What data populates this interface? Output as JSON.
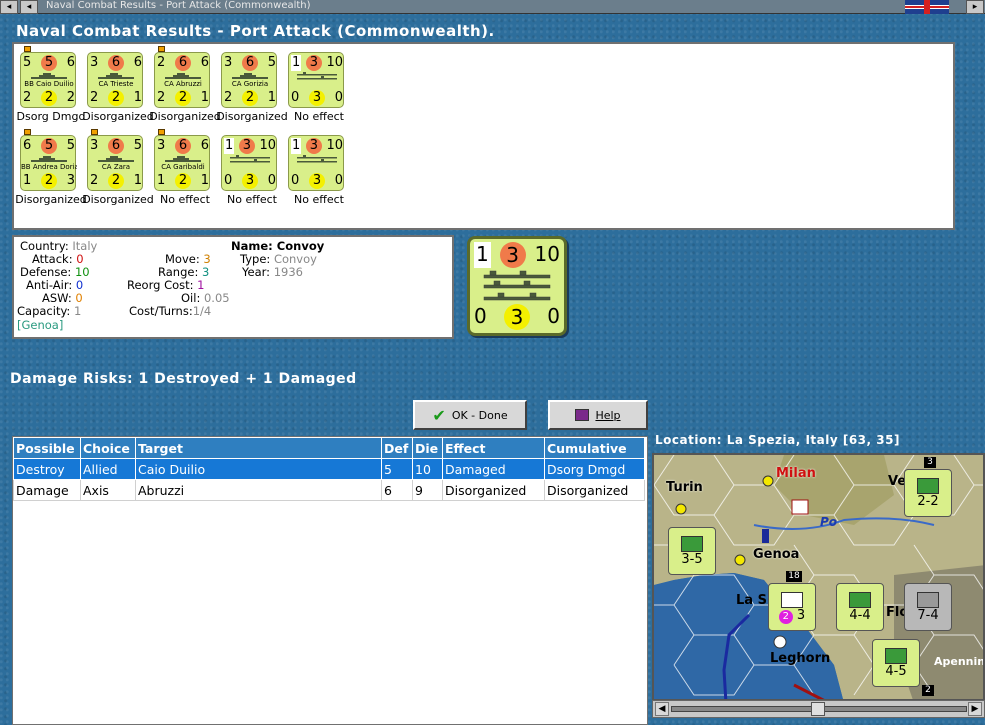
{
  "window": {
    "title": "Naval Combat Results - Port Attack (Commonwealth)"
  },
  "heading": "Naval Combat Results - Port Attack (Commonwealth).",
  "units_row1": [
    {
      "name": "BB Caio Duilio",
      "top": [
        "5",
        "5",
        "6"
      ],
      "bot": [
        "2",
        "2",
        "2"
      ],
      "status": "Dsorg Dmgd",
      "flag": true
    },
    {
      "name": "CA Trieste",
      "top": [
        "3",
        "6",
        "6"
      ],
      "bot": [
        "2",
        "2",
        "1"
      ],
      "status": "Disorganized",
      "flag": false
    },
    {
      "name": "CA Abruzzi",
      "top": [
        "2",
        "6",
        "6"
      ],
      "bot": [
        "2",
        "2",
        "1"
      ],
      "status": "Disorganized",
      "flag": true
    },
    {
      "name": "CA Gorizia",
      "top": [
        "3",
        "6",
        "5"
      ],
      "bot": [
        "2",
        "2",
        "1"
      ],
      "status": "Disorganized",
      "flag": false
    },
    {
      "name": "",
      "top": [
        "1",
        "3",
        "10"
      ],
      "bot": [
        "0",
        "3",
        "0"
      ],
      "status": "No effect",
      "flag": false
    }
  ],
  "units_row2": [
    {
      "name": "BB Andrea Doria",
      "top": [
        "6",
        "5",
        "5"
      ],
      "bot": [
        "1",
        "2",
        "3"
      ],
      "status": "Disorganized",
      "flag": true
    },
    {
      "name": "CA Zara",
      "top": [
        "3",
        "6",
        "5"
      ],
      "bot": [
        "2",
        "2",
        "1"
      ],
      "status": "Disorganized",
      "flag": true
    },
    {
      "name": "CA Garibaldi",
      "top": [
        "3",
        "6",
        "6"
      ],
      "bot": [
        "1",
        "2",
        "1"
      ],
      "status": "No effect",
      "flag": true
    },
    {
      "name": "",
      "top": [
        "1",
        "3",
        "10"
      ],
      "bot": [
        "0",
        "3",
        "0"
      ],
      "status": "No effect",
      "flag": false
    },
    {
      "name": "",
      "top": [
        "1",
        "3",
        "10"
      ],
      "bot": [
        "0",
        "3",
        "0"
      ],
      "status": "No effect",
      "flag": false
    }
  ],
  "info": {
    "country_label": "Country:",
    "country": "Italy",
    "attack_label": "Attack:",
    "attack": "0",
    "defense_label": "Defense:",
    "defense": "10",
    "antiair_label": "Anti-Air:",
    "antiair": "0",
    "asw_label": "ASW:",
    "asw": "0",
    "capacity_label": "Capacity:",
    "capacity": "1",
    "location": "[Genoa]",
    "move_label": "Move:",
    "move": "3",
    "range_label": "Range:",
    "range": "3",
    "reorg_label": "Reorg Cost:",
    "reorg": "1",
    "oil_label": "Oil:",
    "oil": "0.05",
    "costturns_label": "Cost/Turns:",
    "costturns": "1/4",
    "name_label": "Name:",
    "name": "Convoy",
    "type_label": "Type:",
    "type": "Convoy",
    "year_label": "Year:",
    "year": "1936"
  },
  "big_counter": {
    "top": [
      "1",
      "3",
      "10"
    ],
    "bot": [
      "0",
      "3",
      "0"
    ]
  },
  "damage_risks": "Damage Risks: 1 Destroyed + 1 Damaged",
  "buttons": {
    "ok": "OK - Done",
    "help": "Help"
  },
  "table": {
    "headers": [
      "Possible",
      "Choice",
      "Target",
      "Def",
      "Die",
      "Effect",
      "Cumulative"
    ],
    "rows": [
      [
        "Destroy",
        "Allied",
        "Caio Duilio",
        "5",
        "10",
        "Damaged",
        "Dsorg Dmgd"
      ],
      [
        "Damage",
        "Axis",
        "Abruzzi",
        "6",
        "9",
        "Disorganized",
        "Disorganized"
      ]
    ]
  },
  "map": {
    "location": "Location:  La Spezia, Italy [63, 35]",
    "cities": {
      "turin": "Turin",
      "milan": "Milan",
      "genoa": "Genoa",
      "laspezia": "La S",
      "leghorn": "Leghorn",
      "ve": "Ve",
      "apennine": "Apennin",
      "po": "Po",
      "fl": "Flo"
    },
    "units": {
      "u1": "3-5",
      "u2": "2-2",
      "u3": "3",
      "u4": "4-4",
      "u5": "7-4",
      "u6": "4-5",
      "badge_top": "3",
      "badge_stack": "18",
      "badge_bottom": "2",
      "circle_num": "2"
    }
  },
  "colors": {
    "sea": "#2d6e9c",
    "counter": "#d9ef8a",
    "table_header": "#2f7fc0",
    "selected_row": "#1678d6"
  }
}
